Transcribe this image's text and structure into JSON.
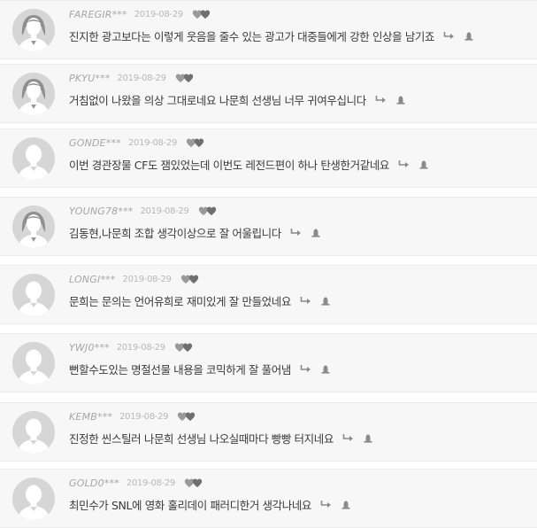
{
  "colors": {
    "row_bg": "#f7f7f7",
    "border": "#ebebeb",
    "username": "#a6a6a6",
    "date": "#b8b8b8",
    "text": "#3a3a3a",
    "icon": "#8a8a8a"
  },
  "comments": [
    {
      "user": "FAREGIR***",
      "date": "2019-08-29",
      "avatar": "female",
      "text": "진지한 광고보다는 이렇게 웃음을 줄수 있는 광고가 대중들에게 강한 인상을 남기죠"
    },
    {
      "user": "PKYU***",
      "date": "2019-08-29",
      "avatar": "female",
      "text": "거침없이 나왔을 의상 그대로네요 나문희 선생님 너무 귀여우십니다"
    },
    {
      "user": "GONDE***",
      "date": "2019-08-29",
      "avatar": "male",
      "text": "이번 경관장물 CF도 잼있었는데 이번도 레전드편이 하나 탄생한거같네요"
    },
    {
      "user": "YOUNG78***",
      "date": "2019-08-29",
      "avatar": "female",
      "text": "김동현,나문희 조합 생각이상으로 잘 어울립니다"
    },
    {
      "user": "LONGI***",
      "date": "2019-08-29",
      "avatar": "male",
      "text": "문희는 문의는 언어유희로 재미있게 잘 만들었네요"
    },
    {
      "user": "YWJ0***",
      "date": "2019-08-29",
      "avatar": "male",
      "text": "뻔할수도있는 명절선물 내용을 코믹하게 잘 풀어냄"
    },
    {
      "user": "KEMB***",
      "date": "2019-08-29",
      "avatar": "male",
      "text": "진정한 씬스틸러 나문희 선생님 나오실때마다 빵빵 터지네요"
    },
    {
      "user": "GOLD0***",
      "date": "2019-08-29",
      "avatar": "male",
      "text": "최민수가 SNL에 영화 홀리데이 패러디한거 생각나네요"
    }
  ]
}
